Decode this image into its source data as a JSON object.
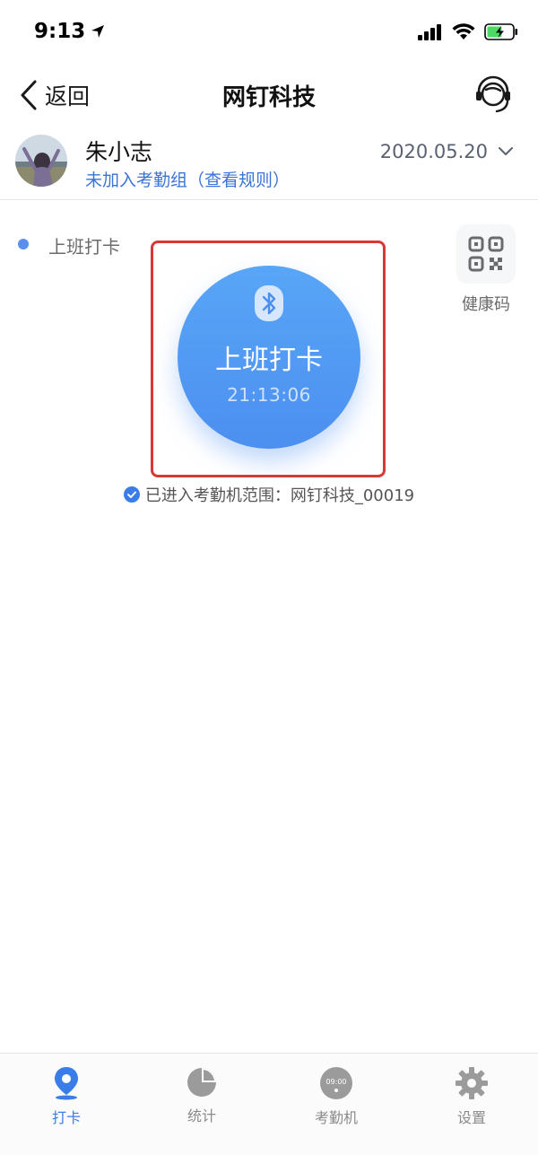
{
  "status_bar": {
    "time": "9:13"
  },
  "nav": {
    "back_label": "返回",
    "title": "网钉科技"
  },
  "profile": {
    "name": "朱小志",
    "subtitle": "未加入考勤组（查看规则）",
    "date": "2020.05.20"
  },
  "clock_in": {
    "section_label": "上班打卡",
    "button_label": "上班打卡",
    "time": "21:13:06",
    "range_text": "已进入考勤机范围：网钉科技_00019",
    "health_code_label": "健康码"
  },
  "tabs": [
    {
      "label": "打卡",
      "icon": "location-pin-icon",
      "active": true
    },
    {
      "label": "统计",
      "icon": "pie-chart-icon",
      "active": false
    },
    {
      "label": "考勤机",
      "icon": "attendance-machine-icon",
      "active": false,
      "icon_text": "09:00"
    },
    {
      "label": "设置",
      "icon": "gear-icon",
      "active": false
    }
  ],
  "colors": {
    "accent": "#3a7de8",
    "button": "#4c8ff0",
    "highlight": "#d73a36"
  }
}
